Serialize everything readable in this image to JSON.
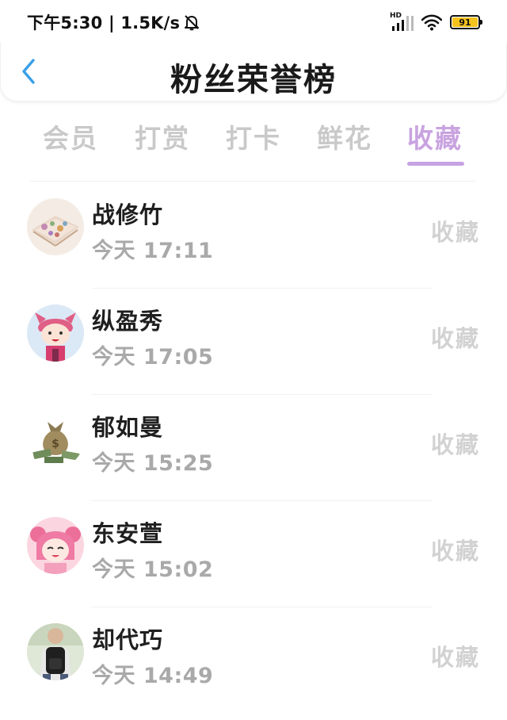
{
  "status_bar": {
    "time_speed": "下午5:30 | 1.5K/s",
    "network_badge": "HD",
    "battery": "91",
    "battery_color": "#f6c21c"
  },
  "header": {
    "back_icon": "chevron-left-icon",
    "title": "粉丝荣誉榜",
    "accent_color": "#3aa0e8"
  },
  "tabs": [
    {
      "label": "会员",
      "active": false
    },
    {
      "label": "打赏",
      "active": false
    },
    {
      "label": "打卡",
      "active": false
    },
    {
      "label": "鲜花",
      "active": false
    },
    {
      "label": "收藏",
      "active": true
    }
  ],
  "tab_active_color": "#c5a3e3",
  "list": [
    {
      "name": "战修竹",
      "time": "今天 17:11",
      "action": "收藏"
    },
    {
      "name": "纵盈秀",
      "time": "今天 17:05",
      "action": "收藏"
    },
    {
      "name": "郁如曼",
      "time": "今天 15:25",
      "action": "收藏"
    },
    {
      "name": "东安萱",
      "time": "今天 15:02",
      "action": "收藏"
    },
    {
      "name": "却代巧",
      "time": "今天 14:49",
      "action": "收藏"
    }
  ]
}
